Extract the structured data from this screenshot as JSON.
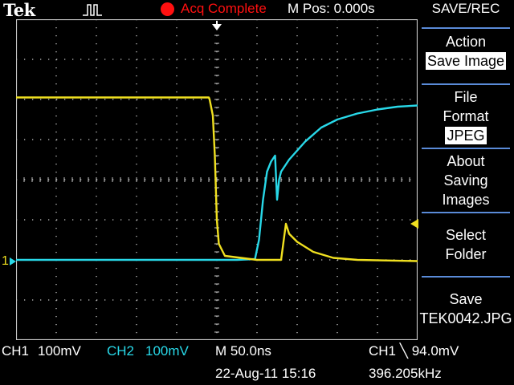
{
  "header": {
    "brand": "Tek",
    "trigger_icon": "pulse-trigger-icon",
    "acq_status": "Acq Complete",
    "m_pos": "M Pos: 0.000s"
  },
  "menu": {
    "title": "SAVE/REC",
    "action_label": "Action",
    "action_value": "Save Image",
    "file_format_line1": "File",
    "file_format_line2": "Format",
    "file_format_value": "JPEG",
    "about_line1": "About",
    "about_line2": "Saving",
    "about_line3": "Images",
    "select_line1": "Select",
    "select_line2": "Folder",
    "save_line1": "Save",
    "save_line2": "TEK0042.JPG"
  },
  "readout": {
    "ch1_label": "CH1",
    "ch1_scale": "100mV",
    "ch2_label": "CH2",
    "ch2_scale": "100mV",
    "timebase": "M 50.0ns",
    "trigger": "CH1 ╲ 94.0mV",
    "datetime": "22-Aug-11 15:16",
    "frequency": "396.205kHz",
    "ch1_marker": "1"
  },
  "colors": {
    "ch1": "#f0e020",
    "ch2": "#28d8e8",
    "record": "#ff1010",
    "grid": "#c8c8c8",
    "menu_separator": "#5a8bd8"
  },
  "chart_data": {
    "type": "line",
    "x_divisions": 10,
    "y_divisions": 8,
    "xlim": [
      0,
      10
    ],
    "ylim": [
      -4,
      4
    ],
    "series": [
      {
        "channel": "CH1",
        "points": [
          [
            0,
            2.05
          ],
          [
            4.8,
            2.05
          ],
          [
            4.82,
            2.0
          ],
          [
            4.9,
            1.6
          ],
          [
            4.95,
            0.6
          ],
          [
            5.0,
            -1.0
          ],
          [
            5.05,
            -1.6
          ],
          [
            5.2,
            -1.9
          ],
          [
            5.6,
            -1.95
          ],
          [
            6.0,
            -2.0
          ],
          [
            6.6,
            -2.0
          ],
          [
            6.68,
            -1.4
          ],
          [
            6.72,
            -1.1
          ],
          [
            6.8,
            -1.35
          ],
          [
            7.0,
            -1.55
          ],
          [
            7.4,
            -1.8
          ],
          [
            7.9,
            -1.95
          ],
          [
            8.5,
            -2.0
          ],
          [
            10,
            -2.03
          ]
        ]
      },
      {
        "channel": "CH2",
        "points": [
          [
            0,
            -2.0
          ],
          [
            5.5,
            -2.0
          ],
          [
            5.95,
            -1.98
          ],
          [
            6.05,
            -1.5
          ],
          [
            6.15,
            -0.5
          ],
          [
            6.25,
            0.2
          ],
          [
            6.35,
            0.45
          ],
          [
            6.45,
            0.6
          ],
          [
            6.5,
            -0.5
          ],
          [
            6.55,
            0.0
          ],
          [
            6.6,
            0.2
          ],
          [
            6.8,
            0.5
          ],
          [
            7.2,
            0.95
          ],
          [
            7.6,
            1.3
          ],
          [
            8.0,
            1.5
          ],
          [
            8.5,
            1.65
          ],
          [
            9.0,
            1.75
          ],
          [
            9.5,
            1.82
          ],
          [
            10,
            1.85
          ]
        ]
      }
    ],
    "trigger_level": -1.06
  }
}
